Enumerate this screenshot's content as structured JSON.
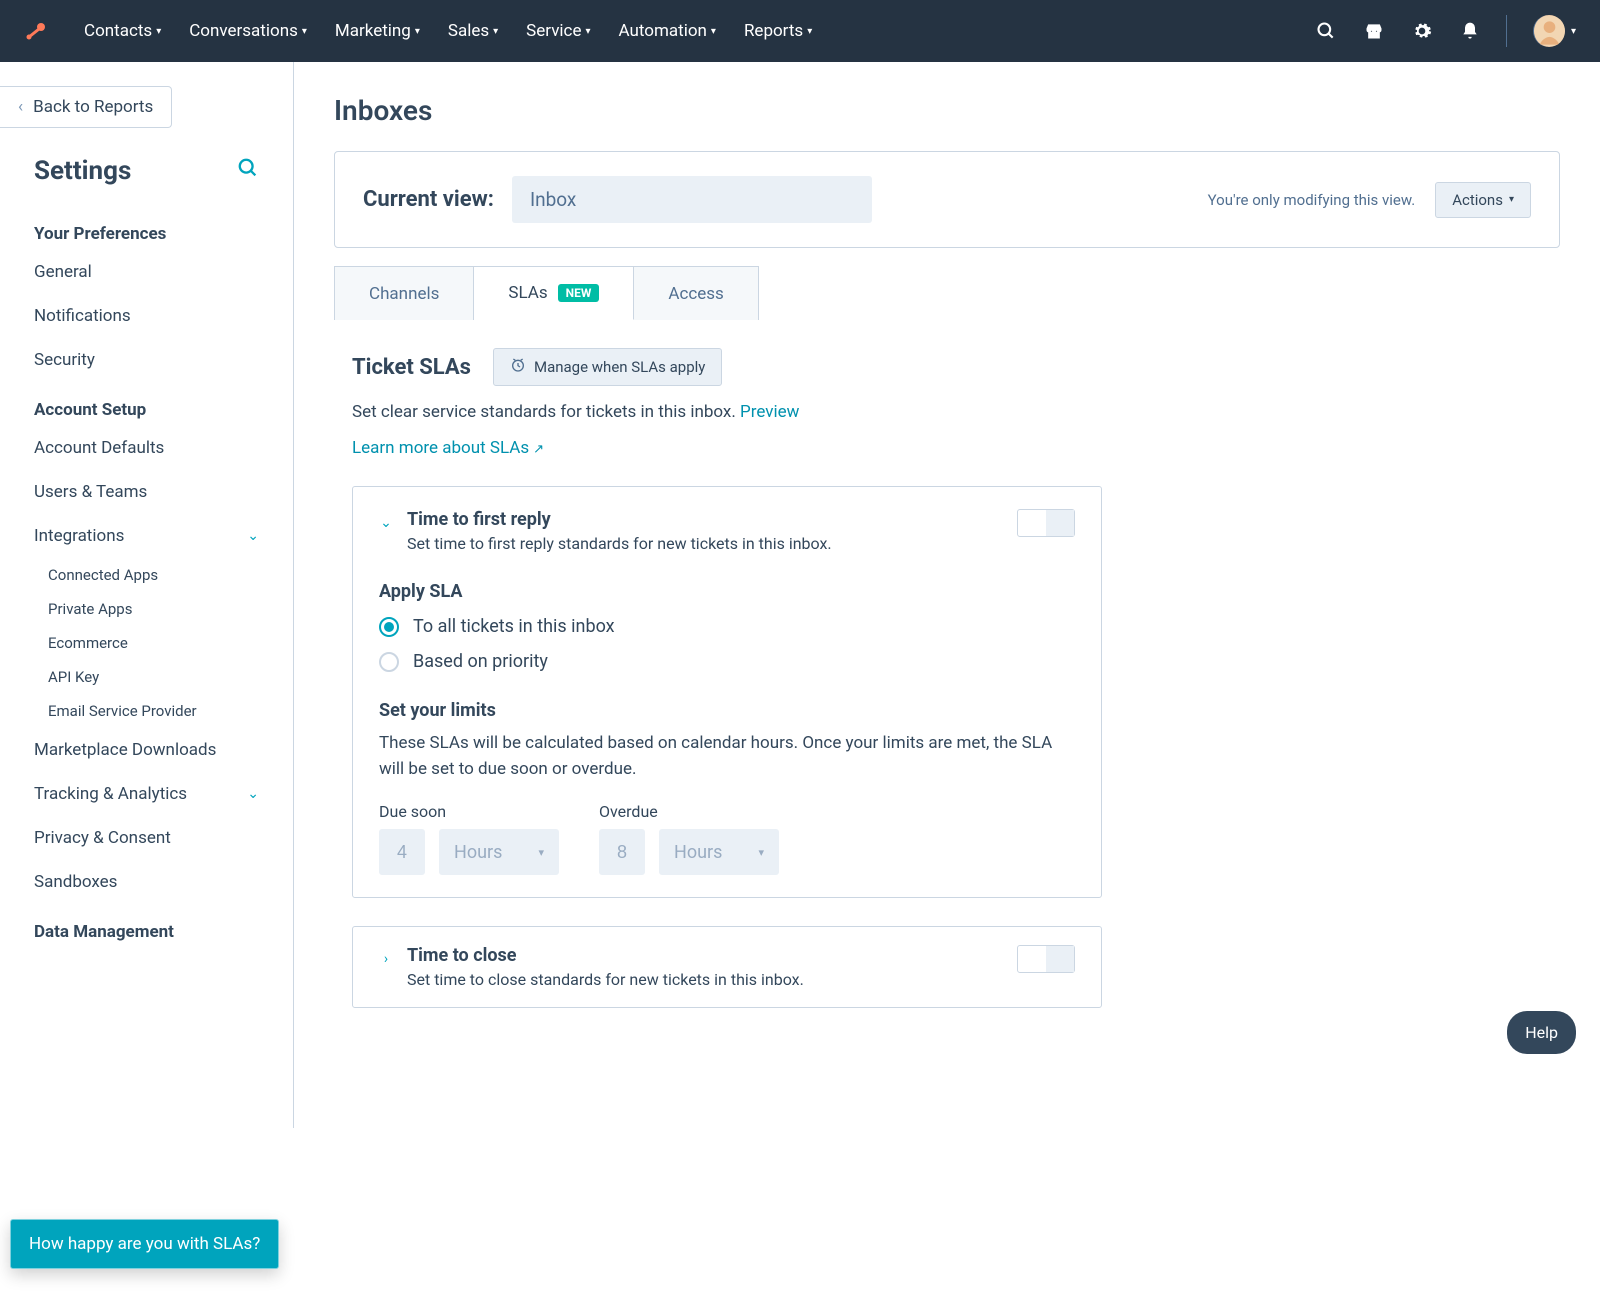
{
  "topnav": {
    "items": [
      "Contacts",
      "Conversations",
      "Marketing",
      "Sales",
      "Service",
      "Automation",
      "Reports"
    ]
  },
  "sidebar": {
    "back": "Back to Reports",
    "title": "Settings",
    "pref_heading": "Your Preferences",
    "pref": [
      "General",
      "Notifications",
      "Security"
    ],
    "acct_heading": "Account Setup",
    "acct": [
      "Account Defaults",
      "Users & Teams",
      "Integrations"
    ],
    "integrations_sub": [
      "Connected Apps",
      "Private Apps",
      "Ecommerce",
      "API Key",
      "Email Service Provider"
    ],
    "acct2": [
      "Marketplace Downloads",
      "Tracking & Analytics",
      "Privacy & Consent",
      "Sandboxes"
    ],
    "data_heading": "Data Management"
  },
  "page": {
    "title": "Inboxes",
    "current_view_label": "Current view:",
    "current_view_value": "Inbox",
    "view_note": "You're only modifying this view.",
    "actions": "Actions"
  },
  "tabs": {
    "channels": "Channels",
    "slas": "SLAs",
    "slas_badge": "NEW",
    "access": "Access"
  },
  "slas": {
    "heading": "Ticket SLAs",
    "manage": "Manage when SLAs apply",
    "desc": "Set clear service standards for tickets in this inbox.",
    "preview": "Preview",
    "learn": "Learn more about SLAs"
  },
  "first_reply": {
    "title": "Time to first reply",
    "sub": "Set time to first reply standards for new tickets in this inbox.",
    "apply_heading": "Apply SLA",
    "opt_all": "To all tickets in this inbox",
    "opt_priority": "Based on priority",
    "limits_heading": "Set your limits",
    "limits_desc": "These SLAs will be calculated based on calendar hours. Once your limits are met, the SLA will be set to due soon or overdue.",
    "due_soon_label": "Due soon",
    "due_soon_value": "4",
    "due_soon_unit": "Hours",
    "overdue_label": "Overdue",
    "overdue_value": "8",
    "overdue_unit": "Hours"
  },
  "time_close": {
    "title": "Time to close",
    "sub": "Set time to close standards for new tickets in this inbox."
  },
  "feedback": "How happy are you with SLAs?",
  "help": "Help"
}
